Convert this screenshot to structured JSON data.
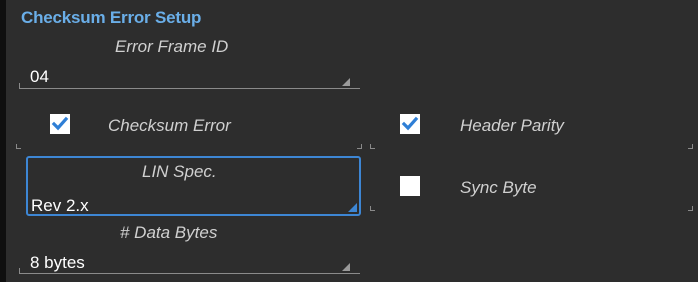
{
  "panel": {
    "title": "Checksum Error Setup"
  },
  "error_frame": {
    "label": "Error Frame ID",
    "value": "04"
  },
  "checksum_error": {
    "label": "Checksum Error",
    "checked": true
  },
  "header_parity": {
    "label": "Header Parity",
    "checked": true
  },
  "lin_spec": {
    "label": "LIN Spec.",
    "value": "Rev 2.x"
  },
  "sync_byte": {
    "label": "Sync Byte",
    "checked": false
  },
  "data_bytes": {
    "label": "# Data Bytes",
    "value": "8 bytes"
  },
  "colors": {
    "background": "#2d2d2d",
    "title": "#6aaee8",
    "accent": "#3d86d4",
    "check": "#2f7fd6"
  },
  "icons": {
    "checkmark": "check-icon",
    "dropdown": "dropdown-triangle-icon"
  }
}
